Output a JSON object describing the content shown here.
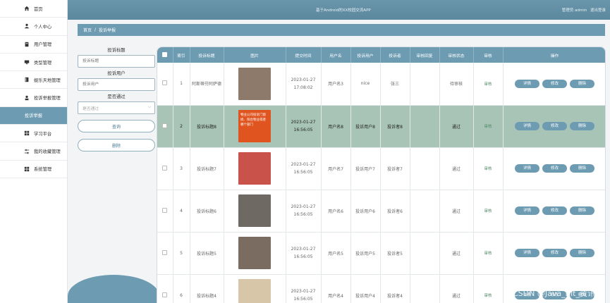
{
  "app_title": "基于Android的XX校园交流APP",
  "user": {
    "label": "管理员 admin",
    "logout": "退出登录"
  },
  "sidebar": {
    "items": [
      {
        "label": "首页",
        "icon": "home-icon"
      },
      {
        "label": "个人中心",
        "icon": "user-icon"
      },
      {
        "label": "用户管理",
        "icon": "doc-icon"
      },
      {
        "label": "类型管理",
        "icon": "monitor-icon"
      },
      {
        "label": "娱乐天地管理",
        "icon": "book-icon"
      },
      {
        "label": "投诉举报管理",
        "icon": "person-icon"
      },
      {
        "label": "投诉举报",
        "icon": ""
      },
      {
        "label": "学习平台",
        "icon": "grid-icon"
      },
      {
        "label": "我的收藏管理",
        "icon": "sliders-icon"
      },
      {
        "label": "系统管理",
        "icon": "grid-icon"
      }
    ]
  },
  "breadcrumb": {
    "home": "首页",
    "sep": "/",
    "current": "投诉举报"
  },
  "search": {
    "title_label": "投诉标题",
    "title_placeholder": "投诉标题",
    "user_label": "投诉用户",
    "user_placeholder": "投诉用户",
    "pass_label": "是否通过",
    "pass_placeholder": "是否通过",
    "query_btn": "查询",
    "delete_btn": "删除"
  },
  "table": {
    "headers": [
      "",
      "索引",
      "投诉标题",
      "图片",
      "提交时间",
      "用户名",
      "投诉用户",
      "投诉者",
      "审核回复",
      "审核状态",
      "审核",
      "操作"
    ],
    "rows": [
      {
        "idx": "1",
        "title": "阿斯蒂芬阿萨德",
        "date": "2023-01-27",
        "time": "17:08:02",
        "username": "用户名3",
        "complaint_user": "nice",
        "complainant": "张三",
        "reply": "",
        "status": "待审核",
        "audit": "审核",
        "thumb_color": "#8d7a6b"
      },
      {
        "idx": "2",
        "title": "投诉标题8",
        "date": "2023-01-27",
        "time": "16:56:05",
        "username": "用户名8",
        "complaint_user": "投诉用户8",
        "complainant": "投诉者8",
        "reply": "",
        "status": "通过",
        "audit": "审核",
        "thumb_color": "#e0551f",
        "thumb_text": "物业公司投诉门窗损、阳台物业或者哪个部门"
      },
      {
        "idx": "3",
        "title": "投诉标题7",
        "date": "2023-01-27",
        "time": "16:56:05",
        "username": "用户名7",
        "complaint_user": "投诉用户7",
        "complainant": "投诉者7",
        "reply": "",
        "status": "通过",
        "audit": "审核",
        "thumb_color": "#c9534a"
      },
      {
        "idx": "4",
        "title": "投诉标题6",
        "date": "2023-01-27",
        "time": "16:56:05",
        "username": "用户名6",
        "complaint_user": "投诉用户6",
        "complainant": "投诉者6",
        "reply": "",
        "status": "通过",
        "audit": "审核",
        "thumb_color": "#6e6a63"
      },
      {
        "idx": "5",
        "title": "投诉标题5",
        "date": "2023-01-27",
        "time": "16:56:05",
        "username": "用户名5",
        "complaint_user": "投诉用户5",
        "complainant": "投诉者5",
        "reply": "",
        "status": "通过",
        "audit": "审核",
        "thumb_color": "#7b6c61"
      },
      {
        "idx": "6",
        "title": "投诉标题4",
        "date": "2023-01-27",
        "time": "16:56:05",
        "username": "用户名4",
        "complaint_user": "投诉用户4",
        "complainant": "投诉者4",
        "reply": "",
        "status": "通过",
        "audit": "审核",
        "thumb_color": "#d8c6a8"
      }
    ],
    "ops": {
      "detail": "详情",
      "edit": "修改",
      "delete": "删除"
    }
  },
  "colors": {
    "primary": "#6d9cb2",
    "highlight_row": "#a8c4b7"
  },
  "watermark": "CSDN @Java_Bit_资讯狮"
}
